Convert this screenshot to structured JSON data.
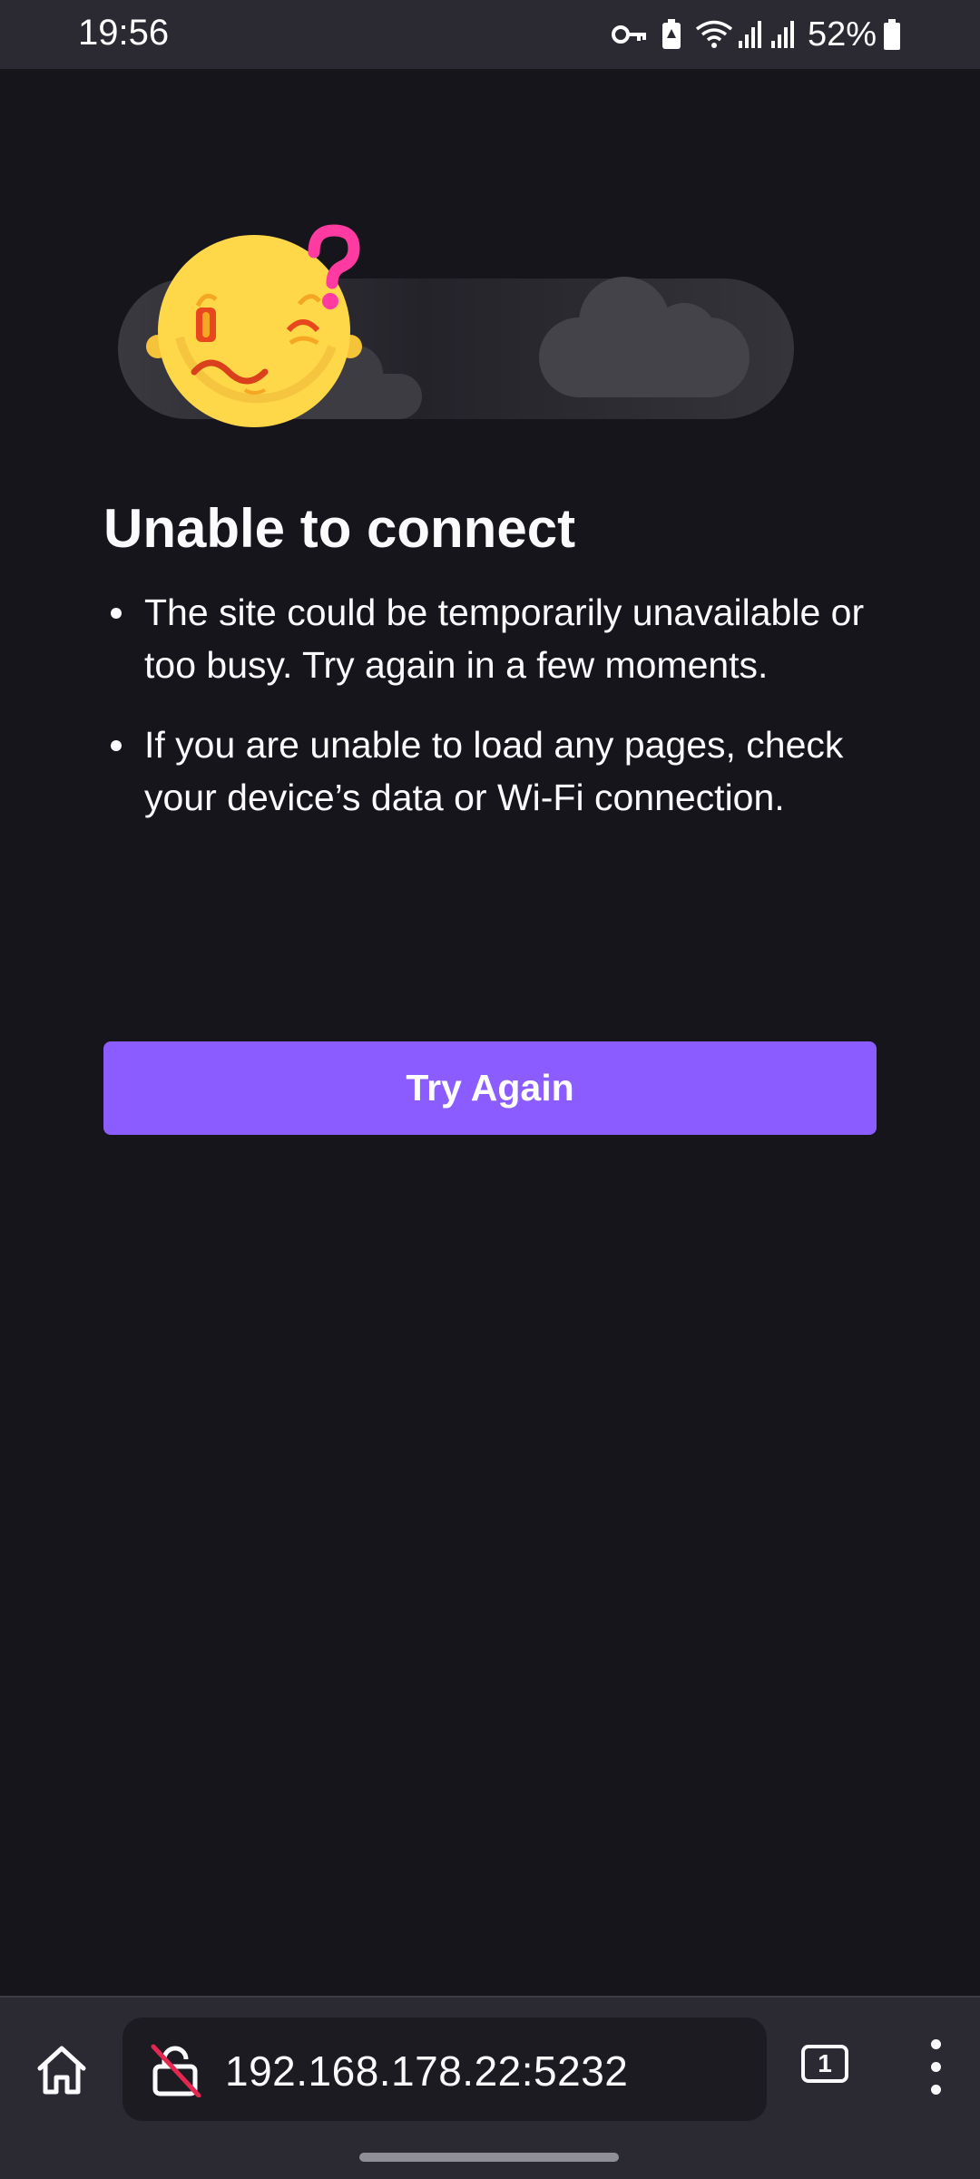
{
  "status_bar": {
    "time": "19:56",
    "battery": "52%",
    "icons": [
      "vpn-key-icon",
      "battery-saver-icon",
      "wifi-icon",
      "signal-icon",
      "signal-icon",
      "battery-icon"
    ]
  },
  "error_page": {
    "illustration": "confused-face-with-clouds",
    "title": "Unable to connect",
    "bullets": [
      "The site could be temporarily unavailable or too busy. Try again in a few moments.",
      "If you are unable to load any pages, check your device’s data or Wi-Fi connection."
    ],
    "try_again_label": "Try Again"
  },
  "toolbar": {
    "home_icon": "home-icon",
    "security_icon": "insecure-lock-icon",
    "url": "192.168.178.22:5232",
    "tab_count": "1",
    "menu_icon": "kebab-menu-icon"
  },
  "colors": {
    "background": "#16151b",
    "bar_background": "#2b2a33",
    "url_field": "#1c1b22",
    "accent": "#8b5cff",
    "face_yellow": "#ffd84a",
    "question_mark": "#ff3aa0",
    "insecure_slash": "#e22850"
  }
}
